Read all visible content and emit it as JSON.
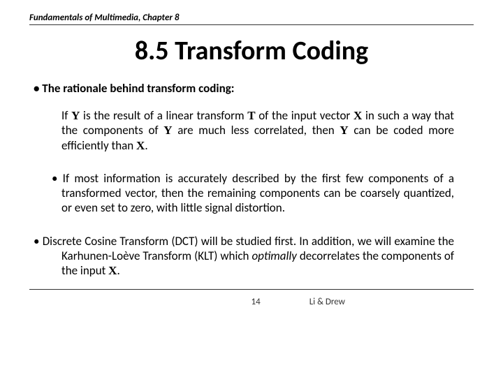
{
  "header": {
    "text": "Fundamentals of Multimedia, Chapter 8"
  },
  "title": "8.5 Transform Coding",
  "bullet1": "• The rationale behind transform coding:",
  "rationale": {
    "p1": "If ",
    "y1": "Y",
    "p2": " is the result of a linear transform ",
    "t1": "T",
    "p3": " of the input vector ",
    "x1": "X",
    "p4": " in such a way that the components of ",
    "y2": "Y",
    "p5": " are much less correlated, then ",
    "y3": "Y",
    "p6": " can be coded more efficiently than ",
    "x2": "X",
    "p7": "."
  },
  "bullet2": "• If most information is accurately described by the first few components of a transformed vector, then the remaining components can be coarsely quantized, or even set to zero, with little signal distortion.",
  "bullet3": {
    "p1": "• Discrete Cosine Transform (DCT) will be studied first. In addition, we will examine the Karhunen-Loève Transform (KLT) which ",
    "opt": "optimally",
    "p2": " decorrelates the components of the input ",
    "x": "X",
    "p3": "."
  },
  "footer": {
    "page": "14",
    "authors": "Li & Drew"
  }
}
